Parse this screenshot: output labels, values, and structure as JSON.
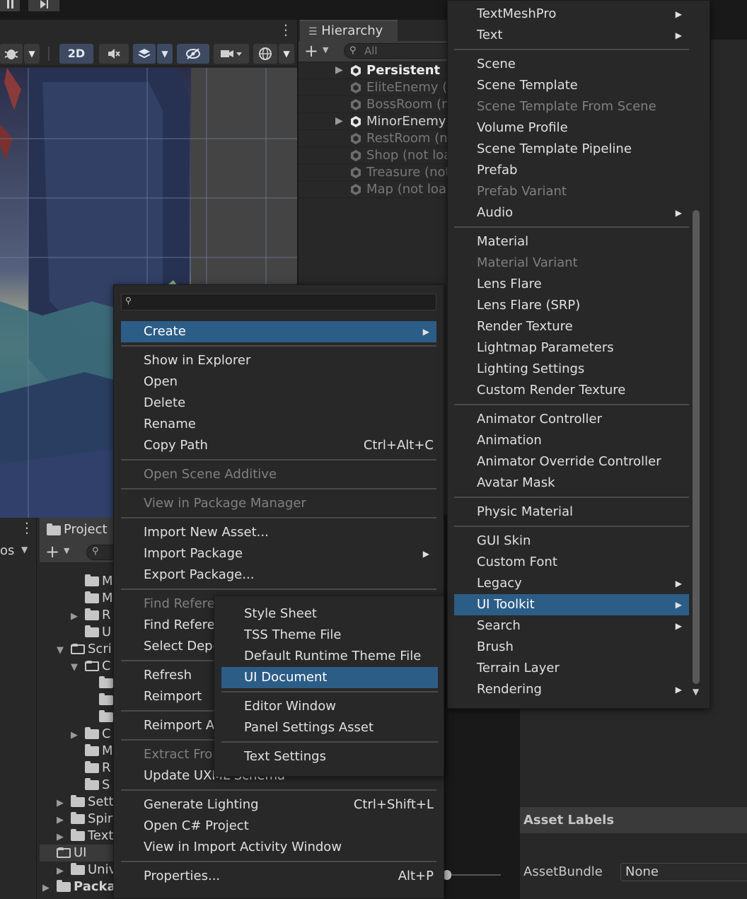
{
  "toolbar": {
    "mode_2d": "2D"
  },
  "hierarchy": {
    "tab_label": "Hierarchy",
    "search_placeholder": "All",
    "rows": [
      {
        "label": "Persistent",
        "style": "strong",
        "expand": true
      },
      {
        "label": "EliteEnemy (n",
        "style": "dim",
        "expand": false
      },
      {
        "label": "BossRoom (n",
        "style": "dim",
        "expand": false
      },
      {
        "label": "MinorEnemy",
        "style": "normal",
        "expand": true
      },
      {
        "label": "RestRoom (no",
        "style": "dim",
        "expand": false
      },
      {
        "label": "Shop (not loa",
        "style": "dim",
        "expand": false
      },
      {
        "label": "Treasure (not",
        "style": "dim",
        "expand": false
      },
      {
        "label": "Map (not load",
        "style": "dim",
        "expand": false
      }
    ]
  },
  "project": {
    "tab_label": "Project",
    "left_fragment": "os",
    "tree": [
      {
        "label": "M",
        "indent": 2,
        "arrow": "",
        "open": false
      },
      {
        "label": "M",
        "indent": 2,
        "arrow": "",
        "open": false
      },
      {
        "label": "R",
        "indent": 2,
        "arrow": "▶",
        "open": false
      },
      {
        "label": "U",
        "indent": 2,
        "arrow": "",
        "open": false
      },
      {
        "label": "Scri",
        "indent": 1,
        "arrow": "▼",
        "open": true
      },
      {
        "label": "C",
        "indent": 2,
        "arrow": "▼",
        "open": true
      },
      {
        "label": "",
        "indent": 3,
        "arrow": "",
        "open": false
      },
      {
        "label": "",
        "indent": 3,
        "arrow": "",
        "open": false
      },
      {
        "label": "",
        "indent": 3,
        "arrow": "",
        "open": false
      },
      {
        "label": "C",
        "indent": 2,
        "arrow": "▶",
        "open": false
      },
      {
        "label": "M",
        "indent": 2,
        "arrow": "",
        "open": false
      },
      {
        "label": "R",
        "indent": 2,
        "arrow": "",
        "open": false
      },
      {
        "label": "S",
        "indent": 2,
        "arrow": "",
        "open": false
      },
      {
        "label": "Sett",
        "indent": 1,
        "arrow": "▶",
        "open": false
      },
      {
        "label": "Spir",
        "indent": 1,
        "arrow": "▶",
        "open": false
      },
      {
        "label": "Text",
        "indent": 1,
        "arrow": "▶",
        "open": false
      },
      {
        "label": "UI",
        "indent": 1,
        "arrow": "",
        "open": true
      },
      {
        "label": "Univ",
        "indent": 1,
        "arrow": "▶",
        "open": false
      },
      {
        "label": "Packa",
        "indent": 0,
        "arrow": "▶",
        "open": false
      }
    ]
  },
  "inspector": {
    "asset_labels": "Asset Labels",
    "assetbundle_label": "AssetBundle",
    "assetbundle_value": "None"
  },
  "context_menu": {
    "items": [
      {
        "label": "Create",
        "state": "highlight",
        "submenu": true,
        "shortcut": ""
      },
      {
        "sep": true
      },
      {
        "label": "Show in Explorer",
        "state": "normal",
        "submenu": false,
        "shortcut": ""
      },
      {
        "label": "Open",
        "state": "normal",
        "submenu": false,
        "shortcut": ""
      },
      {
        "label": "Delete",
        "state": "normal",
        "submenu": false,
        "shortcut": ""
      },
      {
        "label": "Rename",
        "state": "normal",
        "submenu": false,
        "shortcut": ""
      },
      {
        "label": "Copy Path",
        "state": "normal",
        "submenu": false,
        "shortcut": "Ctrl+Alt+C"
      },
      {
        "sep": true
      },
      {
        "label": "Open Scene Additive",
        "state": "disabled",
        "submenu": false,
        "shortcut": ""
      },
      {
        "sep": true
      },
      {
        "label": "View in Package Manager",
        "state": "disabled",
        "submenu": false,
        "shortcut": ""
      },
      {
        "sep": true
      },
      {
        "label": "Import New Asset...",
        "state": "normal",
        "submenu": false,
        "shortcut": ""
      },
      {
        "label": "Import Package",
        "state": "normal",
        "submenu": true,
        "shortcut": ""
      },
      {
        "label": "Export Package...",
        "state": "normal",
        "submenu": false,
        "shortcut": ""
      },
      {
        "sep": true
      },
      {
        "label": "Find Referer",
        "state": "disabled",
        "submenu": false,
        "shortcut": ""
      },
      {
        "label": "Find Referer",
        "state": "normal",
        "submenu": false,
        "shortcut": ""
      },
      {
        "label": "Select Depe",
        "state": "normal",
        "submenu": false,
        "shortcut": ""
      },
      {
        "sep": true
      },
      {
        "label": "Refresh",
        "state": "normal",
        "submenu": false,
        "shortcut": ""
      },
      {
        "label": "Reimport",
        "state": "normal",
        "submenu": false,
        "shortcut": ""
      },
      {
        "sep": true
      },
      {
        "label": "Reimport Al",
        "state": "normal",
        "submenu": false,
        "shortcut": ""
      },
      {
        "sep": true
      },
      {
        "label": "Extract Fror",
        "state": "disabled",
        "submenu": false,
        "shortcut": ""
      },
      {
        "label": "Update UXML Schema",
        "state": "normal",
        "submenu": false,
        "shortcut": ""
      },
      {
        "sep": true
      },
      {
        "label": "Generate Lighting",
        "state": "normal",
        "submenu": false,
        "shortcut": "Ctrl+Shift+L"
      },
      {
        "label": "Open C# Project",
        "state": "normal",
        "submenu": false,
        "shortcut": ""
      },
      {
        "label": "View in Import Activity Window",
        "state": "normal",
        "submenu": false,
        "shortcut": ""
      },
      {
        "sep": true
      },
      {
        "label": "Properties...",
        "state": "normal",
        "submenu": false,
        "shortcut": "Alt+P"
      }
    ]
  },
  "create_menu": {
    "items": [
      {
        "label": "TextMeshPro",
        "state": "normal",
        "submenu": true
      },
      {
        "label": "Text",
        "state": "normal",
        "submenu": true
      },
      {
        "sep": true
      },
      {
        "label": "Scene",
        "state": "normal",
        "submenu": false
      },
      {
        "label": "Scene Template",
        "state": "normal",
        "submenu": false
      },
      {
        "label": "Scene Template From Scene",
        "state": "disabled",
        "submenu": false
      },
      {
        "label": "Volume Profile",
        "state": "normal",
        "submenu": false
      },
      {
        "label": "Scene Template Pipeline",
        "state": "normal",
        "submenu": false
      },
      {
        "label": "Prefab",
        "state": "normal",
        "submenu": false
      },
      {
        "label": "Prefab Variant",
        "state": "disabled",
        "submenu": false
      },
      {
        "label": "Audio",
        "state": "normal",
        "submenu": true
      },
      {
        "sep": true
      },
      {
        "label": "Material",
        "state": "normal",
        "submenu": false
      },
      {
        "label": "Material Variant",
        "state": "disabled",
        "submenu": false
      },
      {
        "label": "Lens Flare",
        "state": "normal",
        "submenu": false
      },
      {
        "label": "Lens Flare (SRP)",
        "state": "normal",
        "submenu": false
      },
      {
        "label": "Render Texture",
        "state": "normal",
        "submenu": false
      },
      {
        "label": "Lightmap Parameters",
        "state": "normal",
        "submenu": false
      },
      {
        "label": "Lighting Settings",
        "state": "normal",
        "submenu": false
      },
      {
        "label": "Custom Render Texture",
        "state": "normal",
        "submenu": false
      },
      {
        "sep": true
      },
      {
        "label": "Animator Controller",
        "state": "normal",
        "submenu": false
      },
      {
        "label": "Animation",
        "state": "normal",
        "submenu": false
      },
      {
        "label": "Animator Override Controller",
        "state": "normal",
        "submenu": false
      },
      {
        "label": "Avatar Mask",
        "state": "normal",
        "submenu": false
      },
      {
        "sep": true
      },
      {
        "label": "Physic Material",
        "state": "normal",
        "submenu": false
      },
      {
        "sep": true
      },
      {
        "label": "GUI Skin",
        "state": "normal",
        "submenu": false
      },
      {
        "label": "Custom Font",
        "state": "normal",
        "submenu": false
      },
      {
        "label": "Legacy",
        "state": "normal",
        "submenu": true
      },
      {
        "label": "UI Toolkit",
        "state": "highlight",
        "submenu": true
      },
      {
        "label": "Search",
        "state": "normal",
        "submenu": true
      },
      {
        "label": "Brush",
        "state": "normal",
        "submenu": false
      },
      {
        "label": "Terrain Layer",
        "state": "normal",
        "submenu": false
      },
      {
        "label": "Rendering",
        "state": "normal",
        "submenu": true
      }
    ]
  },
  "uitk_menu": {
    "items": [
      {
        "label": "Style Sheet",
        "state": "normal"
      },
      {
        "label": "TSS Theme File",
        "state": "normal"
      },
      {
        "label": "Default Runtime Theme File",
        "state": "normal"
      },
      {
        "label": "UI Document",
        "state": "highlight"
      },
      {
        "sep": true
      },
      {
        "label": "Editor Window",
        "state": "normal"
      },
      {
        "label": "Panel Settings Asset",
        "state": "normal"
      },
      {
        "sep": true
      },
      {
        "label": "Text Settings",
        "state": "normal"
      }
    ]
  },
  "colors": {
    "highlight": "#2c5d87",
    "menu_bg": "#282828",
    "disabled_text": "#808080"
  }
}
